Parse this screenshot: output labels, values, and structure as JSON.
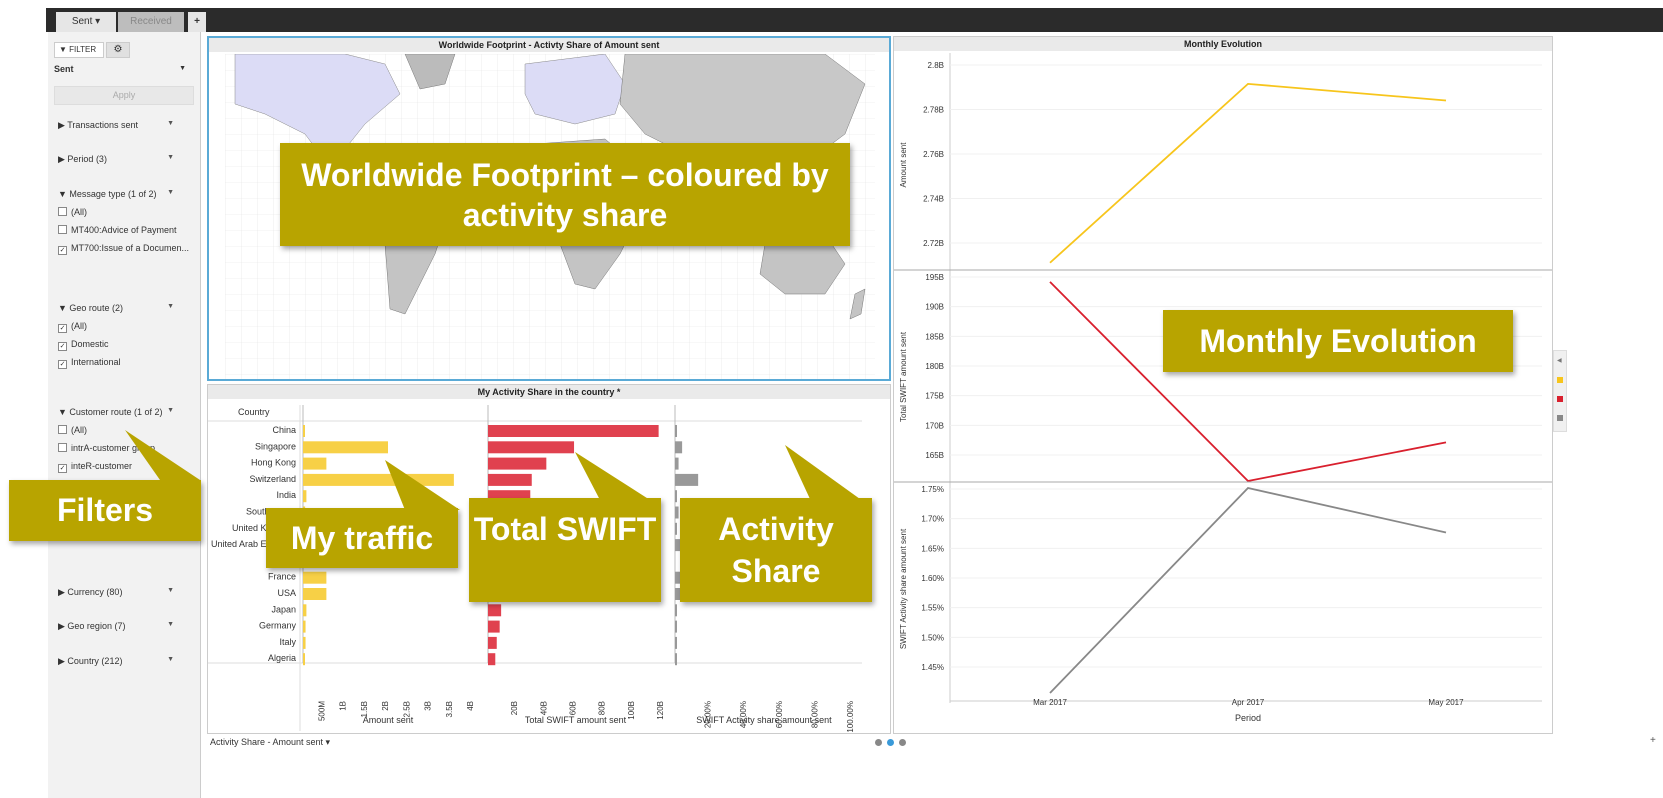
{
  "tabs": [
    {
      "label": "Sent ▾"
    },
    {
      "label": "Received"
    },
    {
      "label": "+"
    }
  ],
  "sidebar": {
    "filter_label": "FILTER",
    "selector_value": "Sent",
    "apply_label": "Apply",
    "sections": [
      {
        "label": "Transactions sent",
        "expanded": false
      },
      {
        "label": "Period (3)",
        "expanded": false
      },
      {
        "label": "Message type (1 of 2)",
        "expanded": true
      },
      {
        "label": "Geo route (2)",
        "expanded": true
      },
      {
        "label": "Customer route (1 of 2)",
        "expanded": true
      },
      {
        "label": "Currency (80)",
        "expanded": false
      },
      {
        "label": "Geo region (7)",
        "expanded": false
      },
      {
        "label": "Country (212)",
        "expanded": false
      }
    ],
    "message_type_options": [
      {
        "label": "(All)",
        "checked": false
      },
      {
        "label": "MT400:Advice of Payment",
        "checked": false
      },
      {
        "label": "MT700:Issue of a Documen...",
        "checked": true
      }
    ],
    "geo_route_options": [
      {
        "label": "(All)",
        "checked": true
      },
      {
        "label": "Domestic",
        "checked": true
      },
      {
        "label": "International",
        "checked": true
      }
    ],
    "customer_route_options": [
      {
        "label": "(All)",
        "checked": false
      },
      {
        "label": "intrA-customer group",
        "checked": false
      },
      {
        "label": "inteR-customer",
        "checked": true
      }
    ]
  },
  "map_panel": {
    "title": "Worldwide Footprint - Activty Share of Amount sent"
  },
  "bar_panel": {
    "title": "My Activity Share in the country *",
    "column_header": "Country",
    "footer_label": "Activity Share - Amount sent ▾"
  },
  "line_panel": {
    "title": "Monthly Evolution"
  },
  "callouts": {
    "worldwide": "Worldwide Footprint – coloured by activity share",
    "monthly": "Monthly Evolution",
    "filters": "Filters",
    "my_traffic": "My traffic",
    "total_swift": "Total SWIFT",
    "activity_share": "Activity Share"
  },
  "colors": {
    "my_traffic": "#f7d046",
    "total_swift": "#e0414f",
    "activity_share": "#999999",
    "callout": "#b8a400",
    "selection": "#5aaad6"
  },
  "chart_data": [
    {
      "type": "bar",
      "title": "My Activity Share in the country *",
      "categories": [
        "China",
        "Singapore",
        "Hong Kong",
        "Switzerland",
        "India",
        "South Korea",
        "United Kingdom",
        "United Arab Emirates",
        "",
        "France",
        "USA",
        "Japan",
        "Germany",
        "Italy",
        "Algeria"
      ],
      "panels": [
        {
          "xlabel": "Amount sent",
          "ticks": [
            "500M",
            "1B",
            "1.5B",
            "2B",
            "2.5B",
            "3B",
            "3.5B",
            "4B"
          ],
          "xlim": [
            0,
            4000000000
          ],
          "color": "#f7d046",
          "values": [
            20000000,
            2000000000,
            550000000,
            3550000000,
            80000000,
            50000000,
            60000000,
            50000000,
            0,
            550000000,
            550000000,
            80000000,
            60000000,
            60000000,
            40000000
          ]
        },
        {
          "xlabel": "Total SWIFT amount sent",
          "ticks": [
            "20B",
            "40B",
            "60B",
            "80B",
            "100B",
            "120B"
          ],
          "xlim": [
            0,
            120000000000
          ],
          "color": "#e0414f",
          "values": [
            117000000000,
            59000000000,
            40000000000,
            30000000000,
            29000000000,
            25000000000,
            20000000000,
            18000000000,
            0,
            14000000000,
            12000000000,
            9000000000,
            8000000000,
            6000000000,
            5000000000
          ]
        },
        {
          "xlabel": "SWIFT Activity share amount sent",
          "ticks": [
            "20.00%",
            "40.00%",
            "60.00%",
            "80.00%",
            "100.00%"
          ],
          "xlim": [
            0,
            100
          ],
          "color": "#999999",
          "values": [
            1,
            4,
            2,
            13,
            1,
            2,
            1,
            3,
            0,
            3,
            4,
            1,
            1,
            1,
            1
          ]
        }
      ]
    },
    {
      "type": "line",
      "title": "Monthly Evolution",
      "x": [
        "Mar 2017",
        "Apr 2017",
        "May 2017"
      ],
      "xlabel": "Period",
      "panels": [
        {
          "ylabel": "Amount sent",
          "color": "#f7c51c",
          "ylim": [
            2.7,
            2.8
          ],
          "ticks": [
            "2.8B",
            "2.78B",
            "2.76B",
            "2.74B",
            "2.72B"
          ],
          "values": [
            2.703,
            2.789,
            2.781
          ]
        },
        {
          "ylabel": "Total SWIFT amount sent",
          "color": "#d9202e",
          "ylim": [
            160,
            195
          ],
          "ticks": [
            "195B",
            "190B",
            "185B",
            "180B",
            "175B",
            "170B",
            "165B"
          ],
          "values": [
            193.5,
            160.0,
            166.5
          ]
        },
        {
          "ylabel": "SWIFT Activity share amount sent",
          "color": "#888888",
          "ylim": [
            1.4,
            1.75
          ],
          "ticks": [
            "1.75%",
            "1.70%",
            "1.65%",
            "1.60%",
            "1.55%",
            "1.50%",
            "1.45%"
          ],
          "values": [
            1.4,
            1.745,
            1.67
          ]
        }
      ]
    }
  ]
}
